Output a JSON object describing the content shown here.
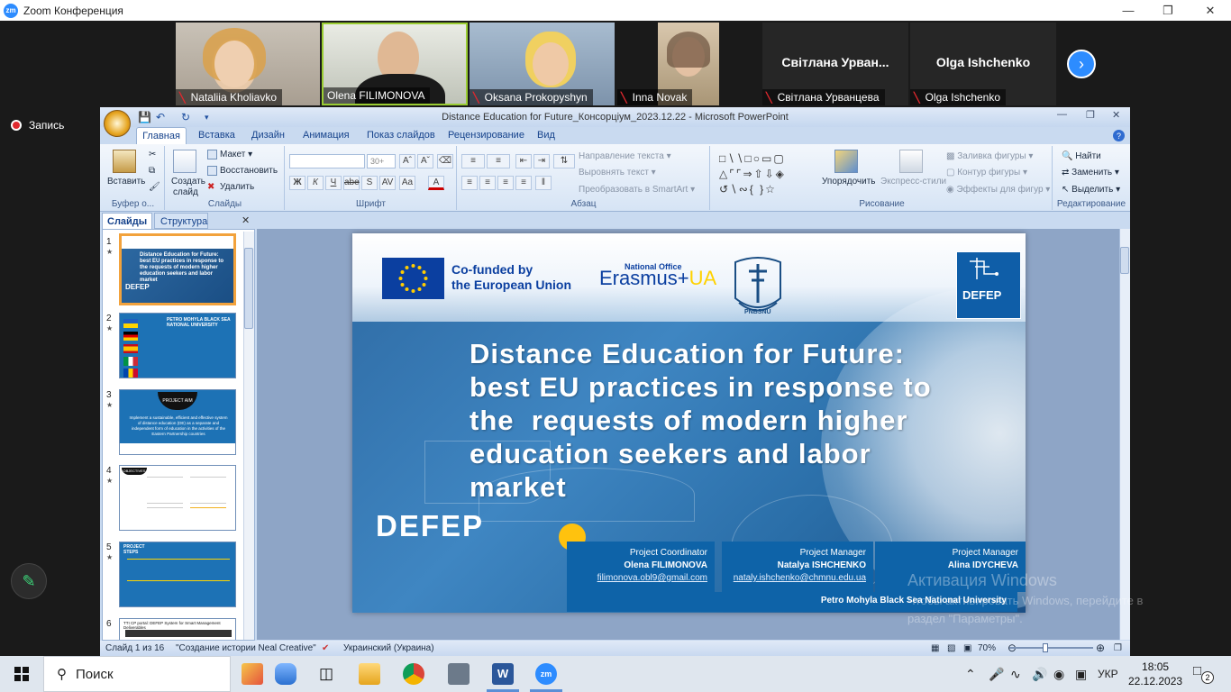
{
  "zoom": {
    "logo_text": "zm",
    "window_title": "Zoom Конференция",
    "recording_label": "Запись",
    "participants": [
      {
        "name": "Nataliia Kholiavko"
      },
      {
        "name": "Olena FILIMONOVA"
      },
      {
        "name": "Oksana Prokopyshyn"
      },
      {
        "name": "Inna Novak"
      },
      {
        "name": "Світлана Урванцева",
        "tile_title": "Світлана  Урван..."
      },
      {
        "name": "Olga Ishchenko",
        "tile_title": "Olga Ishchenko"
      }
    ],
    "next_icon": "chevron-right-icon",
    "accent_color": "#2d8cff"
  },
  "ppt": {
    "window_title": "Distance Education for Future_Консорціум_2023.12.22 - Microsoft PowerPoint",
    "tabs": [
      "Главная",
      "Вставка",
      "Дизайн",
      "Анимация",
      "Показ слайдов",
      "Рецензирование",
      "Вид"
    ],
    "ribbon": {
      "clipboard": {
        "paste": "Вставить",
        "label": "Буфер о..."
      },
      "slides": {
        "new_slide_1": "Создать",
        "new_slide_2": "слайд",
        "layout": "Макет",
        "reset": "Восстановить",
        "delete": "Удалить",
        "label": "Слайды"
      },
      "font": {
        "size": "30+",
        "label": "Шрифт"
      },
      "paragraph": {
        "text_direction": "Направление текста",
        "align_text": "Выровнять текст",
        "smartart": "Преобразовать в SmartArt",
        "label": "Абзац"
      },
      "drawing": {
        "arrange": "Упорядочить",
        "quick_styles": "Экспресс-стили",
        "fill": "Заливка фигуры",
        "outline": "Контур фигуры",
        "effects": "Эффекты для фигур",
        "label": "Рисование"
      },
      "editing": {
        "find": "Найти",
        "replace": "Заменить",
        "select": "Выделить",
        "label": "Редактирование"
      }
    },
    "panel_tabs": {
      "slides": "Слайды",
      "outline": "Структура"
    },
    "status": {
      "slide": "Слайд 1 из 16",
      "theme": "\"Создание истории Neal Creative\"",
      "language": "Украинский (Украина)",
      "zoom": "70%"
    }
  },
  "slide": {
    "eu_line1": "Co-funded by",
    "eu_line2": "the European Union",
    "erasmus_small": "National Office",
    "erasmus_word": "Erasmus+",
    "erasmus_ua": "UA",
    "pnu": "PNBSNU",
    "defep_logo": "DEFEP",
    "title_lines": [
      "Distance Education for Future:",
      "best EU practices in response to",
      "the  requests of modern higher",
      "education seekers and labor",
      "market"
    ],
    "defep_word": "DEFEP",
    "people": [
      {
        "role": "Project Coordinator",
        "name": "Olena FILIMONOVA",
        "email": "filimonova.obl9@gmail.com"
      },
      {
        "role": "Project Manager",
        "name": "Natalya ISHCHENKO",
        "email": "nataly.ishchenko@chmnu.edu.ua"
      },
      {
        "role": "Project Manager",
        "name": "Alina IDYCHEVA",
        "email": ""
      }
    ],
    "university": "Petro Mohyla Black Sea National University"
  },
  "thumbs": {
    "t1_title": "Distance Education for Future: best EU practices in response to the requests of modern higher education seekers and labor market",
    "t1_brand": "DEFEP",
    "t2_text": "PETRO MOHYLA BLACK SEA NATIONAL UNIVERSITY",
    "t3_badge": "PROJECT AIM",
    "t3_text": "Implement a sustainable, efficient and effective system of distance education (DE) as a separate and independent form of education in the activities of the Eastern Partnership countries",
    "t4_badge": "OBJECTIVES",
    "t5_badge": "PROJECT STEPS",
    "t6_text": "TTI CP portal: DEFEP System for Smart Management Deliverables"
  },
  "watermark": {
    "line1": "Активация Windows",
    "line2": "Чтобы активировать Windows, перейдите в",
    "line3": "раздел \"Параметры\"."
  },
  "taskbar": {
    "search": "Поиск",
    "language": "УКР",
    "time": "18:05",
    "date": "22.12.2023",
    "notifications": "2"
  }
}
